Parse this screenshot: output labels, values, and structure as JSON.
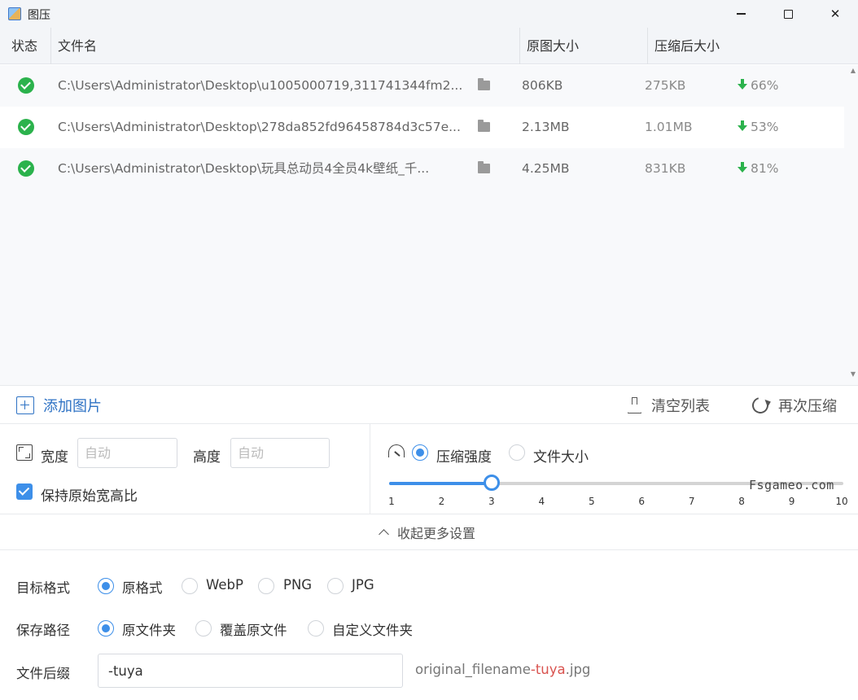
{
  "window": {
    "title": "图压"
  },
  "table": {
    "headers": {
      "status": "状态",
      "filename": "文件名",
      "original_size": "原图大小",
      "compressed_size": "压缩后大小"
    },
    "rows": [
      {
        "status": "done",
        "path": "C:\\Users\\Administrator\\Desktop\\u1005000719,311741344fm2...",
        "original": "806KB",
        "compressed": "275KB",
        "ratio": "66%"
      },
      {
        "status": "done",
        "path": "C:\\Users\\Administrator\\Desktop\\278da852fd96458784d3c57e...",
        "original": "2.13MB",
        "compressed": "1.01MB",
        "ratio": "53%"
      },
      {
        "status": "done",
        "path": "C:\\Users\\Administrator\\Desktop\\玩具总动员4全员4k壁纸_千...",
        "original": "4.25MB",
        "compressed": "831KB",
        "ratio": "81%"
      }
    ]
  },
  "toolbar": {
    "add_label": "添加图片",
    "clear_label": "清空列表",
    "recompress_label": "再次压缩"
  },
  "resize": {
    "width_label": "宽度",
    "width_placeholder": "自动",
    "width_value": "",
    "height_label": "高度",
    "height_placeholder": "自动",
    "height_value": "",
    "keep_ratio_label": "保持原始宽高比",
    "keep_ratio_checked": true
  },
  "compression": {
    "mode_strength_label": "压缩强度",
    "mode_size_label": "文件大小",
    "selected_mode": "strength",
    "level": 3,
    "min": 1,
    "max": 10,
    "ticks": [
      "1",
      "2",
      "3",
      "4",
      "5",
      "6",
      "7",
      "8",
      "9",
      "10"
    ]
  },
  "watermark": "Fsgameo.com",
  "collapse_label": "收起更多设置",
  "format": {
    "label": "目标格式",
    "options": [
      "原格式",
      "WebP",
      "PNG",
      "JPG"
    ],
    "selected": 0
  },
  "save_path": {
    "label": "保存路径",
    "options": [
      "原文件夹",
      "覆盖原文件",
      "自定义文件夹"
    ],
    "selected": 0
  },
  "suffix": {
    "label": "文件后缀",
    "value": "-tuya",
    "preview_prefix": "original_filename",
    "preview_suffix": "-tuya",
    "preview_ext": ".jpg"
  },
  "colors": {
    "accent": "#3d8fe9",
    "success": "#2bb24c",
    "link": "#2e72c4",
    "suffix_highlight": "#d9534f"
  }
}
